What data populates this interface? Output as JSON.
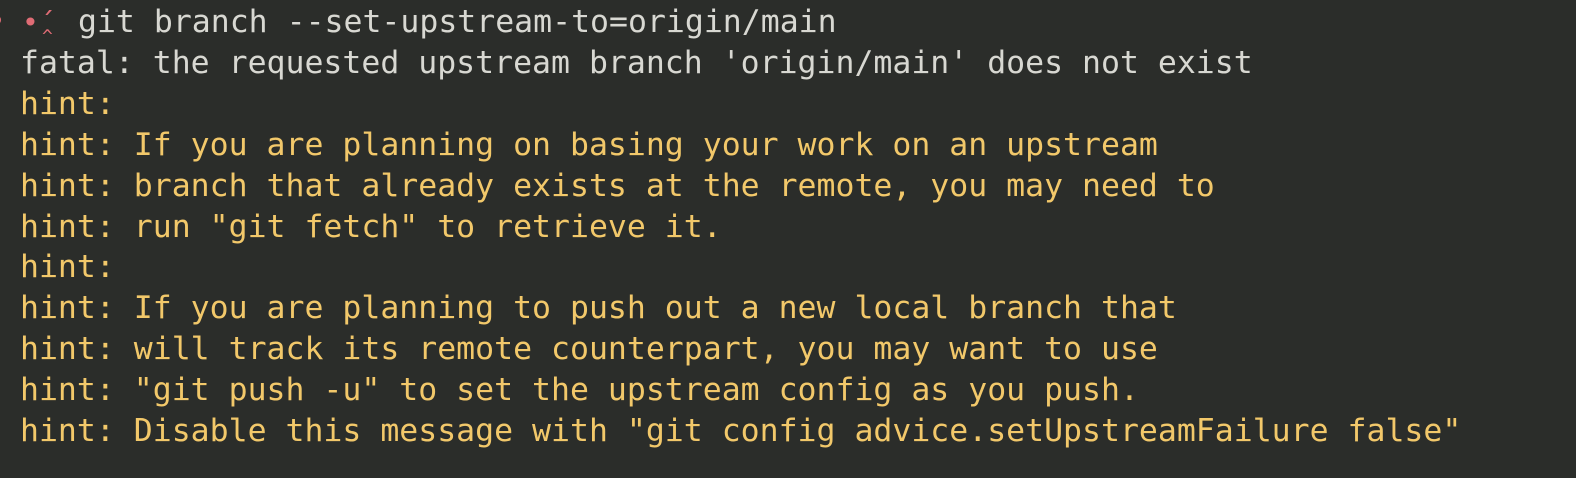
{
  "prompt": {
    "status": "error",
    "symbol": "•´",
    "command": "git branch --set-upstream-to=origin/main"
  },
  "output": [
    {
      "kind": "fatal",
      "text": "fatal: the requested upstream branch 'origin/main' does not exist"
    },
    {
      "kind": "hint",
      "text": "hint:"
    },
    {
      "kind": "hint",
      "text": "hint: If you are planning on basing your work on an upstream"
    },
    {
      "kind": "hint",
      "text": "hint: branch that already exists at the remote, you may need to"
    },
    {
      "kind": "hint",
      "text": "hint: run \"git fetch\" to retrieve it."
    },
    {
      "kind": "hint",
      "text": "hint:"
    },
    {
      "kind": "hint",
      "text": "hint: If you are planning to push out a new local branch that"
    },
    {
      "kind": "hint",
      "text": "hint: will track its remote counterpart, you may want to use"
    },
    {
      "kind": "hint",
      "text": "hint: \"git push -u\" to set the upstream config as you push."
    },
    {
      "kind": "hint",
      "text": "hint: Disable this message with \"git config advice.setUpstreamFailure false\""
    }
  ],
  "colors": {
    "background": "#2b2d2a",
    "fatal": "#d8d8d2",
    "hint": "#f2c86a",
    "error_marker": "#e06c75"
  }
}
